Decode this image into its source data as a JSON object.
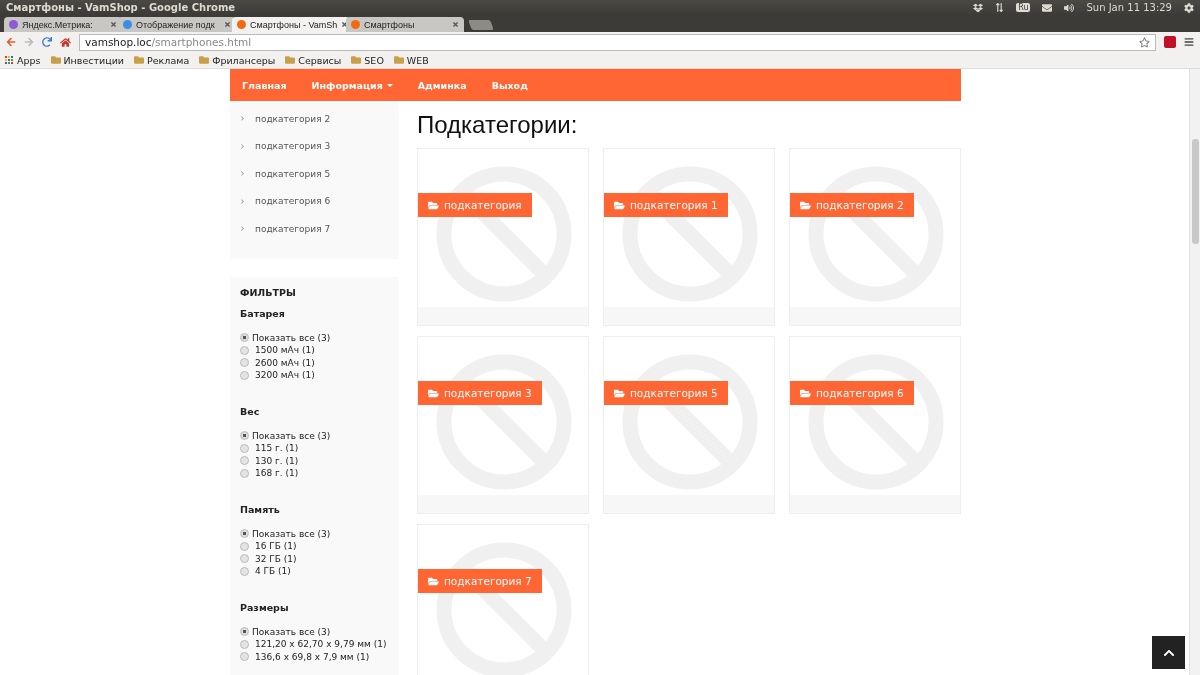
{
  "window": {
    "title": "Смартфоны - VamShop - Google Chrome"
  },
  "tray": {
    "keyboard": "Ru",
    "clock": "Sun Jan 11 13:29"
  },
  "tabs": [
    {
      "label": "Яндекс.Метрика:",
      "selected": false,
      "color": "#8e5bd6"
    },
    {
      "label": "Отображение подк",
      "selected": false,
      "color": "#3a8ee6"
    },
    {
      "label": "Смартфоны - VamSh",
      "selected": true,
      "color": "#f26a10"
    },
    {
      "label": "Смартфоны",
      "selected": false,
      "color": "#f26a10"
    }
  ],
  "address_bar": {
    "host": "vamshop.loc",
    "path": "/smartphones.html"
  },
  "bookmarks": [
    {
      "label": "Apps",
      "kind": "apps"
    },
    {
      "label": "Инвестиции",
      "kind": "folder"
    },
    {
      "label": "Реклама",
      "kind": "folder"
    },
    {
      "label": "Фрилансеры",
      "kind": "folder"
    },
    {
      "label": "Сервисы",
      "kind": "folder"
    },
    {
      "label": "SEO",
      "kind": "folder"
    },
    {
      "label": "WEB",
      "kind": "folder"
    }
  ],
  "nav": [
    {
      "label": "Главная",
      "dropdown": false
    },
    {
      "label": "Информация",
      "dropdown": true
    },
    {
      "label": "Админка",
      "dropdown": false
    },
    {
      "label": "Выход",
      "dropdown": false
    }
  ],
  "sidebar": {
    "categories": [
      "подкатегория 2",
      "подкатегория 3",
      "подкатегория 5",
      "подкатегория 6",
      "подкатегория 7"
    ]
  },
  "filters": {
    "title": "ФИЛЬТРЫ",
    "groups": [
      {
        "title": "Батарея",
        "options": [
          {
            "label": "Показать все (3)",
            "selected": true
          },
          {
            "label": "1500 мАч (1)",
            "selected": false
          },
          {
            "label": "2600 мАч (1)",
            "selected": false
          },
          {
            "label": "3200 мАч (1)",
            "selected": false
          }
        ]
      },
      {
        "title": "Вес",
        "options": [
          {
            "label": "Показать все (3)",
            "selected": true
          },
          {
            "label": "115 г. (1)",
            "selected": false
          },
          {
            "label": "130 г. (1)",
            "selected": false
          },
          {
            "label": "168 г. (1)",
            "selected": false
          }
        ]
      },
      {
        "title": "Память",
        "options": [
          {
            "label": "Показать все (3)",
            "selected": true
          },
          {
            "label": "16 ГБ (1)",
            "selected": false
          },
          {
            "label": "32 ГБ (1)",
            "selected": false
          },
          {
            "label": "4 ГБ (1)",
            "selected": false
          }
        ]
      },
      {
        "title": "Размеры",
        "options": [
          {
            "label": "Показать все (3)",
            "selected": true
          },
          {
            "label": "121,20 x 62,70 x 9,79 мм (1)",
            "selected": false
          },
          {
            "label": "136,6 x 69,8 x 7,9 мм (1)",
            "selected": false
          }
        ]
      }
    ]
  },
  "heading": "Подкатегории:",
  "subcategories": [
    "подкатегория",
    "подкатегория 1",
    "подкатегория 2",
    "подкатегория 3",
    "подкатегория 5",
    "подкатегория 6",
    "подкатегория 7"
  ]
}
